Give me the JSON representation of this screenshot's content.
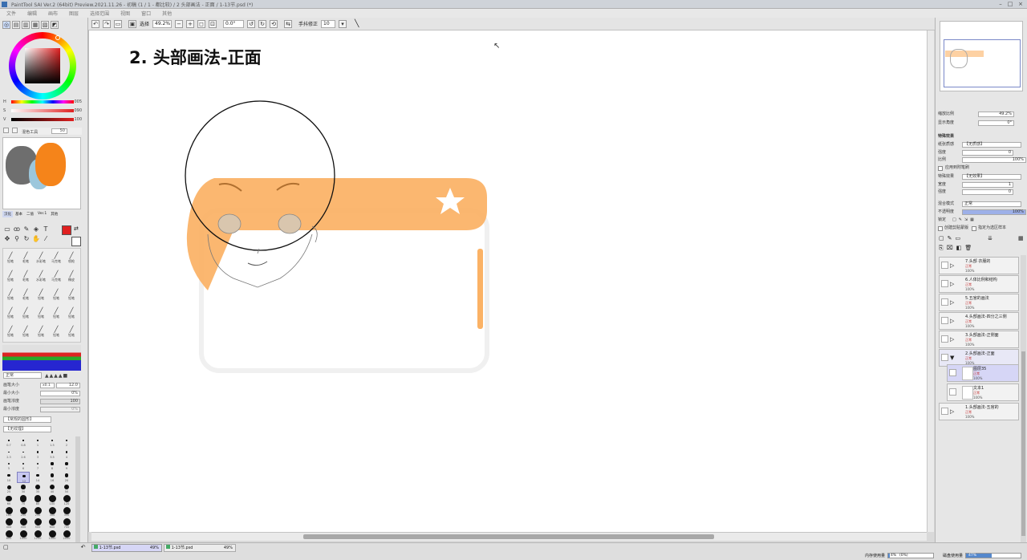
{
  "window": {
    "title": "PaintTool SAI Ver.2 (64bit) Preview.2021.11.26 - 初稿 (1 / 1 - 都比较) / 2 头部画法 - 正面 / 1-13节.psd (*)"
  },
  "menu": [
    "文件",
    "编辑",
    "画布",
    "图层",
    "选择范围",
    "视图",
    "窗口",
    "其他"
  ],
  "toolbar": {
    "select_label": "选择",
    "zoom": "49.2%",
    "angle": "0.0°",
    "stabilizer_label": "手抖修正",
    "stabilizer_value": "10"
  },
  "left_panel": {
    "hsv": [
      {
        "label": "H",
        "value": "005"
      },
      {
        "label": "S",
        "value": "090"
      },
      {
        "label": "V",
        "value": "100"
      }
    ],
    "mix_label": "混色工具",
    "mix_value": "50",
    "tool_tabs": [
      "汉化",
      "基本",
      "二值",
      "Ver.1",
      "其他"
    ],
    "blend_mode": "正常",
    "brush_size_label": "画笔大小",
    "brush_size_mult": "x0.1",
    "brush_size_value": "12.0",
    "min_size_label": "最小大小",
    "min_size_value": "0%",
    "density_label": "画笔浓度",
    "density_value": "100",
    "min_density_label": "最小浓度",
    "min_density_value": "0%",
    "shape_select": "【常规的圆形】",
    "texture_select": "【无纹理】",
    "size_rows": [
      [
        "0.7",
        "0.8",
        "1",
        "1.5",
        "2"
      ],
      [
        "2.3",
        "2.6",
        "3",
        "3.5",
        "4"
      ],
      [
        "5",
        "6",
        "7",
        "8",
        "9"
      ],
      [
        "10",
        "12",
        "14",
        "16",
        "20"
      ],
      [
        "25",
        "30",
        "35",
        "40",
        "50"
      ],
      [
        "60",
        "70",
        "80",
        "100",
        "120"
      ],
      [
        "160",
        "200",
        "250",
        "300",
        "350"
      ],
      [
        "400",
        "450",
        "500",
        "600",
        "700"
      ],
      [
        "800",
        "1000",
        "1200",
        "1500",
        "2000"
      ]
    ],
    "brush_labels": [
      [
        "铅笔",
        "毛笔",
        "水彩笔",
        "马克笔",
        "喷枪"
      ],
      [
        "铅笔",
        "毛笔",
        "水彩笔",
        "马克笔",
        "橡皮"
      ],
      [
        "铅笔",
        "毛笔",
        "铅笔",
        "铅笔",
        "铅笔"
      ],
      [
        "铅笔",
        "铅笔",
        "铅笔",
        "铅笔",
        "铅笔"
      ],
      [
        "铅笔",
        "铅笔",
        "铅笔",
        "铅笔",
        "铅笔"
      ]
    ]
  },
  "canvas": {
    "heading": "2. 头部画法-正面"
  },
  "right_panel": {
    "scale_label": "缩放比例",
    "scale_value": "49.2%",
    "angle_label": "显示角度",
    "angle_value": "0°",
    "effects_header": "特殊效果",
    "texture_label": "纸张质感",
    "texture_value": "【无质感】",
    "strength_label": "强度",
    "strength_value": "0",
    "ratio_label": "比例",
    "ratio_value": "100%",
    "apply_brush_label": "应用到附笔刷",
    "effect_label": "特殊效果",
    "effect_value": "【无效果】",
    "width_label": "宽度",
    "width_value": "1",
    "intensity_label": "强度",
    "intensity_value": "0",
    "blend_label": "混合模式",
    "blend_value": "正常",
    "opacity_label": "不透明度",
    "opacity_value": "100%",
    "lock_label": "锁定",
    "clip_label": "创建剪贴蒙版",
    "ref_label": "指定为选区样本",
    "layers": [
      {
        "name": "7.头部 衣服的",
        "mode": "正常",
        "opacity": "100%"
      },
      {
        "name": "6.人体比例和结构",
        "mode": "正常",
        "opacity": "100%"
      },
      {
        "name": "5.五官的画法",
        "mode": "正常",
        "opacity": "100%"
      },
      {
        "name": "4.头部画法-四分之三侧",
        "mode": "正常",
        "opacity": "100%"
      },
      {
        "name": "3.头部画法-正侧面",
        "mode": "正常",
        "opacity": "100%"
      },
      {
        "name": "2.头部画法-正面",
        "mode": "正常",
        "opacity": "100%"
      },
      {
        "name": "图层35",
        "mode": "正常",
        "opacity": "100%"
      },
      {
        "name": "文本1",
        "mode": "正常",
        "opacity": "100%"
      },
      {
        "name": "1.头部画法-五官的",
        "mode": "正常",
        "opacity": "100%"
      }
    ]
  },
  "status": {
    "tabs": [
      {
        "name": "1-13节.psd",
        "zoom": "49%"
      },
      {
        "name": "1-13节.psd",
        "zoom": "49%"
      }
    ],
    "memory_label": "内存使用量",
    "memory_value": "4%",
    "memory_detail": "(0%)",
    "disk_label": "磁盘使用量",
    "disk_value": "47%"
  },
  "colors": {
    "banner": "#fbb265",
    "accent_red": "#e02020",
    "selected_layer": "#d6d6f6"
  }
}
